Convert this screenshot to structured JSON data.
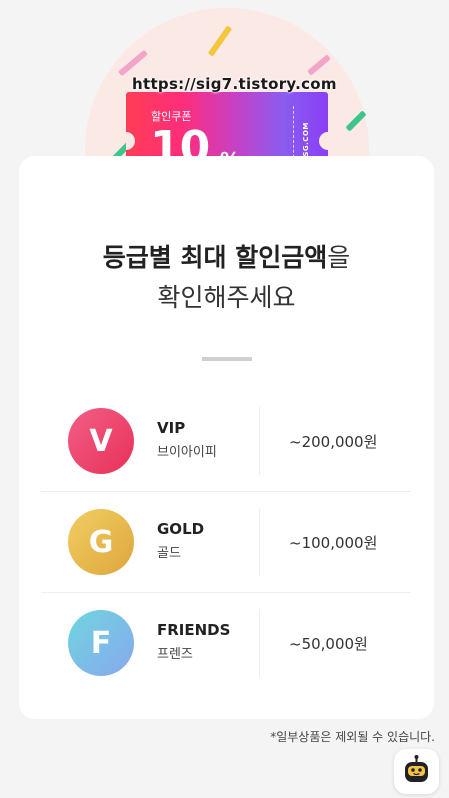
{
  "watermark": "https://sig7.tistory.com",
  "coupon": {
    "label": "할인쿠폰",
    "value": "10",
    "percent": "%",
    "brand": "SSG.COM"
  },
  "headline": {
    "part1_bold": "등급별 최대 할인금액",
    "part1_suffix": "을",
    "line2": "확인해주세요"
  },
  "tiers": [
    {
      "badge": "V",
      "name": "VIP",
      "sub": "브이아이피",
      "amount": "~200,000원",
      "color_from": "#f25f86",
      "color_to": "#e8305a"
    },
    {
      "badge": "G",
      "name": "GOLD",
      "sub": "골드",
      "amount": "~100,000원",
      "color_from": "#f1ce62",
      "color_to": "#dda63d"
    },
    {
      "badge": "F",
      "name": "FRIENDS",
      "sub": "프렌즈",
      "amount": "~50,000원",
      "color_from": "#6fd6df",
      "color_to": "#88a7ee"
    }
  ],
  "footnote": "*일부상품은 제외될 수 있습니다.",
  "bot_icon": "robot-chat-icon"
}
